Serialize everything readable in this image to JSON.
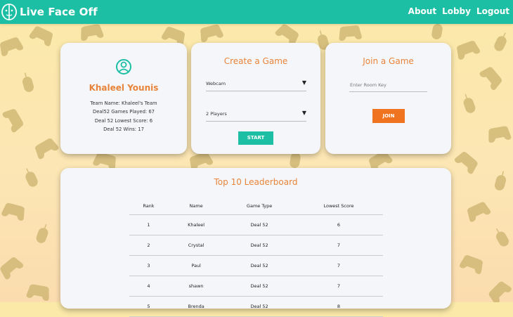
{
  "navbar": {
    "brand": "Live Face Off",
    "links": [
      "About",
      "Lobby",
      "Logout"
    ]
  },
  "profile": {
    "name": "Khaleel Younis",
    "team": "Team Name: Khaleel's Team",
    "games_played": "Deal52 Games Played: 67",
    "lowest_score": "Deal 52 Lowest Score: 6",
    "wins": "Deal 52 Wins: 17"
  },
  "create": {
    "title": "Create a Game",
    "mode": "Webcam",
    "players": "2 Players",
    "start_label": "START"
  },
  "join": {
    "title": "Join a Game",
    "placeholder": "Enter Room Key",
    "join_label": "JOIN"
  },
  "leaderboard": {
    "title": "Top 10 Leaderboard",
    "headers": [
      "Rank",
      "Name",
      "Game Type",
      "Lowest Score"
    ],
    "rows": [
      [
        "1",
        "Khaleel",
        "Deal 52",
        "6"
      ],
      [
        "2",
        "Crystal",
        "Deal 52",
        "7"
      ],
      [
        "3",
        "Paul",
        "Deal 52",
        "7"
      ],
      [
        "4",
        "shawn",
        "Deal 52",
        "7"
      ],
      [
        "5",
        "Brenda",
        "Deal 52",
        "8"
      ]
    ]
  },
  "colors": {
    "accent": "#1dbfa4",
    "title_orange": "#e8843a",
    "join_button": "#f0741f"
  }
}
